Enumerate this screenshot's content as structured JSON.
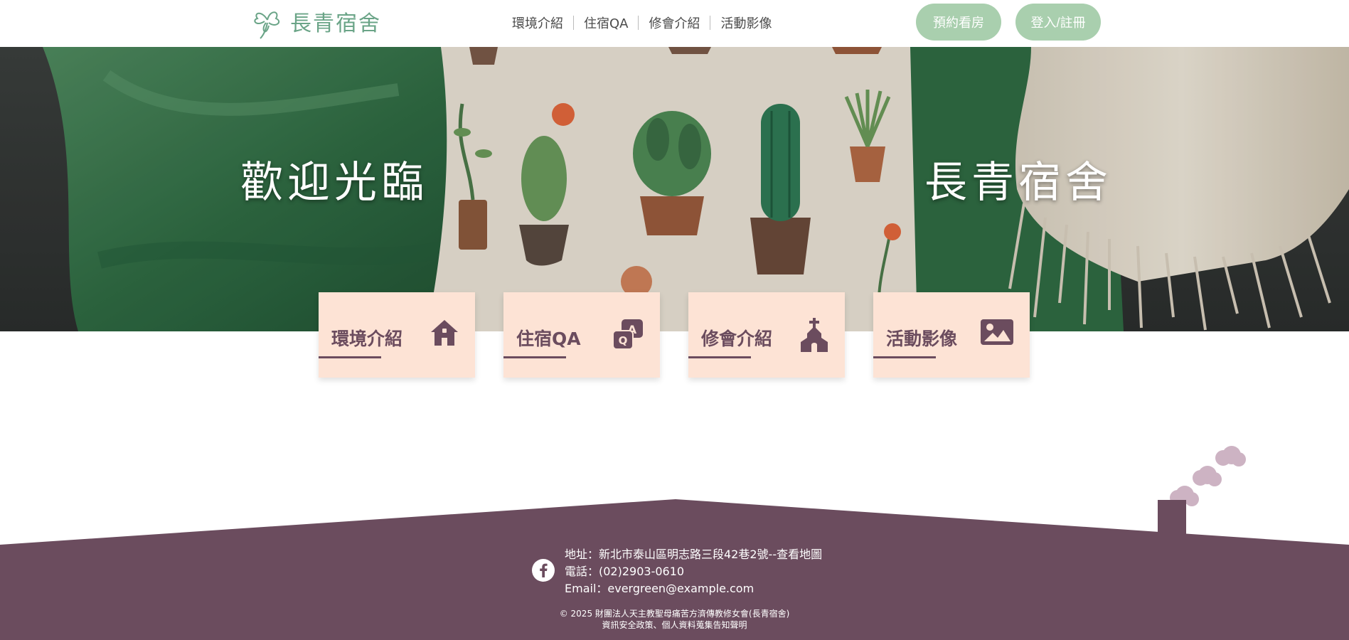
{
  "header": {
    "logo_text": "長青宿舍",
    "nav": [
      "環境介紹",
      "住宿QA",
      "修會介紹",
      "活動影像"
    ],
    "book_button": "預約看房",
    "login_button": "登入/註冊"
  },
  "hero": {
    "left_title": "歡迎光臨",
    "right_title": "長青宿舍"
  },
  "cards": [
    {
      "label": "環境介紹",
      "icon": "house-icon"
    },
    {
      "label": "住宿QA",
      "icon": "qa-icon"
    },
    {
      "label": "修會介紹",
      "icon": "church-icon"
    },
    {
      "label": "活動影像",
      "icon": "image-icon"
    }
  ],
  "footer": {
    "address": "地址：新北市泰山區明志路三段42巷2號--查看地圖",
    "phone": "電話：(02)2903-0610",
    "email": "Email：evergreen@example.com",
    "copyright": "© 2025 財團法人天主教聖母痛苦方濟傳教修女會(長青宿舍)",
    "policy": "資訊安全政策、個人資料蒐集告知聲明"
  },
  "colors": {
    "brand_green": "#6aa487",
    "button_green": "#a9cfae",
    "card_bg": "#fde3d5",
    "accent_purple": "#6b4c5e",
    "footer_bg": "#6b4c5e"
  }
}
